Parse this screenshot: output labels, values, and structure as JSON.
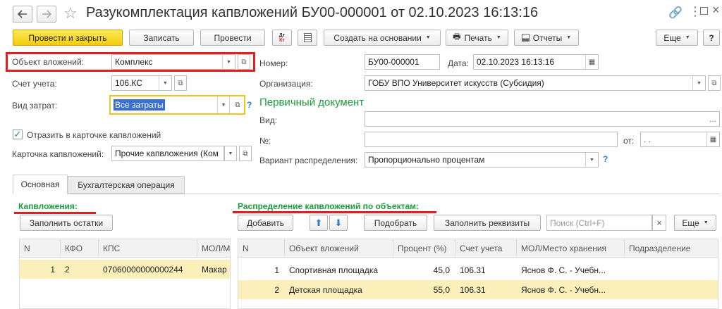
{
  "window": {
    "title": "Разукомплектация капвложений БУ00-000001 от 02.10.2023 16:13:16"
  },
  "toolbar": {
    "post_close": "Провести и закрыть",
    "save": "Записать",
    "post": "Провести",
    "dtkt_top": "Дт",
    "dtkt_bottom": "Кт",
    "create_based": "Создать на основании",
    "print": "Печать",
    "reports": "Отчеты",
    "more": "Еще",
    "help": "?"
  },
  "form": {
    "object_label": "Объект вложений:",
    "object_value": "Комплекс",
    "account_label": "Счет учета:",
    "account_value": "106.КС",
    "cost_label": "Вид затрат:",
    "cost_value": "Все затраты",
    "reflect_label": "Отразить в карточке капвложений",
    "card_label": "Карточка капвложений:",
    "card_value": "Прочие капвложения (Ком",
    "number_label": "Номер:",
    "number_value": "БУ00-000001",
    "date_label": "Дата:",
    "date_value": "02.10.2023 16:13:16",
    "org_label": "Организация:",
    "org_value": "ГОБУ ВПО Университет искусств (Субсидия)",
    "primary_doc_title": "Первичный документ",
    "kind_label": "Вид:",
    "num_label": "№:",
    "from_label": "от:",
    "from_value": " .  .",
    "variant_label": "Вариант распределения:",
    "variant_value": "Пропорционально процентам",
    "help_mark": "?"
  },
  "tabs": [
    {
      "label": "Основная"
    },
    {
      "label": "Бухгалтерская операция"
    }
  ],
  "left_panel": {
    "title": "Капвложения:",
    "fill_button": "Заполнить остатки",
    "columns": [
      "N",
      "КФО",
      "КПС",
      "МОЛ/М"
    ],
    "rows": [
      {
        "n": "1",
        "kfo": "2",
        "kps": "07060000000000244",
        "mol": "Макар"
      }
    ]
  },
  "right_panel": {
    "title": "Распределение капвложений по объектам:",
    "add_button": "Добавить",
    "select_button": "Подобрать",
    "fill_props_button": "Заполнить реквизиты",
    "search_placeholder": "Поиск (Ctrl+F)",
    "clear": "×",
    "more": "Еще",
    "columns": [
      "N",
      "Объект вложений",
      "Процент (%)",
      "Счет учета",
      "МОЛ/Место хранения",
      "Подразделение"
    ],
    "rows": [
      {
        "n": "1",
        "object": "Спортивная площадка",
        "percent": "45,0",
        "account": "106.31",
        "mol": "Яснов Ф. С. - Учебн...",
        "dept": ""
      },
      {
        "n": "2",
        "object": "Детская площадка",
        "percent": "55,0",
        "account": "106.31",
        "mol": "Яснов Ф. С. - Учебн...",
        "dept": ""
      }
    ]
  },
  "colors": {
    "primary_button": "#f5cc0b",
    "accent_green": "#1a9d3c",
    "highlight_red": "#e02020",
    "selected_row": "#fbf0b9",
    "focus_border": "#f0c419"
  }
}
